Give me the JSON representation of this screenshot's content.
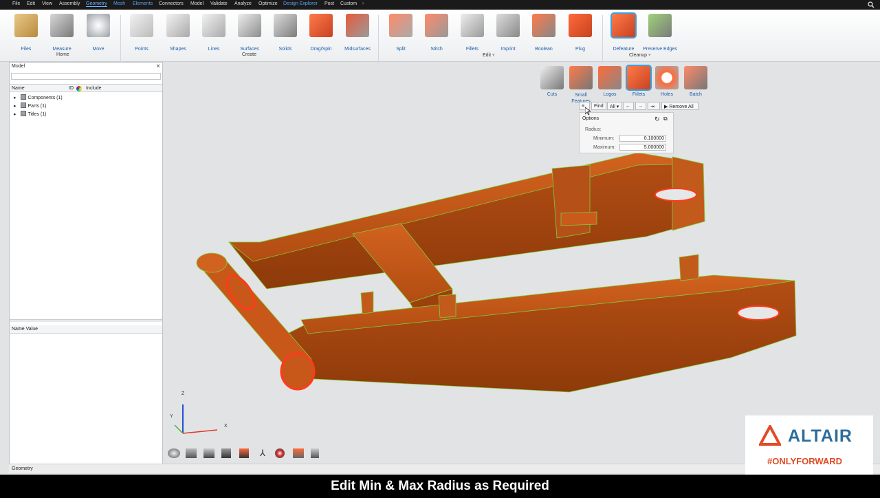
{
  "menu": {
    "items": [
      "File",
      "Edit",
      "View",
      "Assembly",
      "Geometry",
      "Mesh",
      "Elements",
      "Connectors",
      "Model",
      "Validate",
      "Analyze",
      "Optimize",
      "Design Explorer",
      "Post",
      "Custom"
    ],
    "add": "+"
  },
  "ribbon": {
    "home_tools": [
      "Files",
      "Measure",
      "Move"
    ],
    "home_group": "Home",
    "create_tools": [
      "Points",
      "Shapes",
      "Lines",
      "Surfaces",
      "Solids",
      "Drag/Spin",
      "Midsurfaces"
    ],
    "create_group": "Create",
    "edit_tools": [
      "Split",
      "Stitch",
      "Fillets",
      "Imprint",
      "Boolean",
      "Plug"
    ],
    "edit_group": "Edit",
    "cleanup_tools": [
      "Defeature",
      "Preserve Edges"
    ],
    "cleanup_group": "Cleanup",
    "chevron": "▾"
  },
  "subtools": {
    "items": [
      "Cuts",
      "Small Features",
      "Logos",
      "Fillets",
      "Holes",
      "Batch"
    ]
  },
  "findbar": {
    "find": "Find",
    "all": "All",
    "remove_all": "Remove All"
  },
  "options": {
    "title": "Options",
    "radius": "Radius:",
    "min_label": "Minimum:",
    "min_value": "0.100000",
    "max_label": "Maximum:",
    "max_value": "5.000000"
  },
  "panel": {
    "title": "Model",
    "col_name": "Name",
    "col_id": "ID",
    "col_include": "Include",
    "tree": [
      "Components (1)",
      "Parts (1)",
      "Titles (1)"
    ],
    "props_header": "Name Value",
    "close": "×"
  },
  "triad": {
    "z": "Z",
    "y": "Y",
    "x": "X"
  },
  "status": {
    "text": "Geometry"
  },
  "caption": {
    "text": "Edit Min & Max Radius as Required"
  },
  "logo": {
    "brand": "ALTAIR",
    "tagline": "#ONLYFORWARD"
  },
  "colors": {
    "part": "#c8581a",
    "highlight": "#ff3a1a",
    "edge": "#7fd03a",
    "brand_orange": "#e14b26",
    "ribbon_blue": "#1f5fae"
  }
}
